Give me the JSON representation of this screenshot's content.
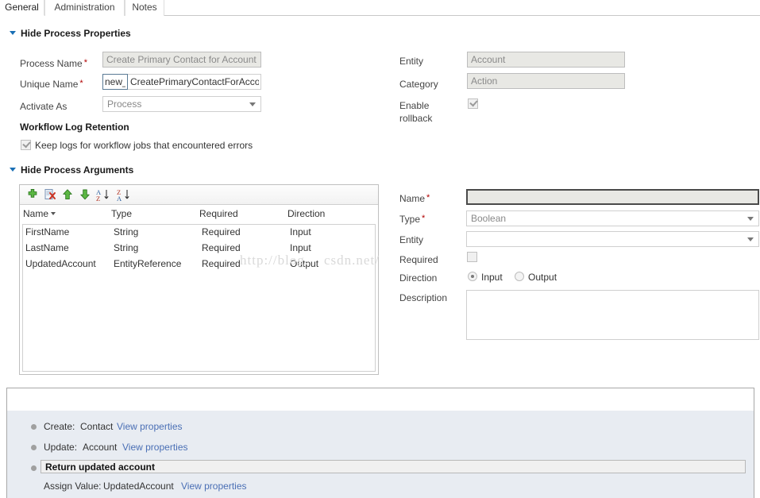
{
  "tabs": [
    {
      "label": "General",
      "active": true
    },
    {
      "label": "Administration",
      "active": false
    },
    {
      "label": "Notes",
      "active": false
    }
  ],
  "sections": {
    "properties_header": "Hide Process Properties",
    "arguments_header": "Hide Process Arguments",
    "log_retention_header": "Workflow Log Retention"
  },
  "properties": {
    "process_name_label": "Process Name",
    "process_name_value": "Create Primary Contact for Account",
    "unique_name_label": "Unique Name",
    "unique_name_prefix": "new_",
    "unique_name_value": "CreatePrimaryContactForAccount",
    "activate_as_label": "Activate As",
    "activate_as_value": "Process",
    "entity_label": "Entity",
    "entity_value": "Account",
    "category_label": "Category",
    "category_value": "Action",
    "enable_rollback_label": "Enable rollback",
    "enable_rollback_checked": true,
    "keep_logs_label": "Keep logs for workflow jobs that encountered errors",
    "keep_logs_checked": true
  },
  "arguments_toolbar": [
    {
      "name": "add-argument",
      "glyph": "+",
      "color": "#3d9b35"
    },
    {
      "name": "delete-argument",
      "glyph": "⌧",
      "color": "#c23c2a"
    },
    {
      "name": "move-up",
      "glyph": "▲",
      "color": "#3d9b35"
    },
    {
      "name": "move-down",
      "glyph": "▼",
      "color": "#3d9b35"
    },
    {
      "name": "sort-ascending",
      "glyph": "AZ",
      "color": "#3b6fa8"
    },
    {
      "name": "sort-descending",
      "glyph": "ZA",
      "color": "#3b6fa8"
    }
  ],
  "arguments_grid": {
    "columns": [
      "Name",
      "Type",
      "Required",
      "Direction"
    ],
    "sorted_column": "Name",
    "rows": [
      {
        "name": "FirstName",
        "type": "String",
        "required": "Required",
        "direction": "Input"
      },
      {
        "name": "LastName",
        "type": "String",
        "required": "Required",
        "direction": "Input"
      },
      {
        "name": "UpdatedAccount",
        "type": "EntityReference",
        "required": "Required",
        "direction": "Output"
      }
    ]
  },
  "argument_detail": {
    "name_label": "Name",
    "name_value": "",
    "type_label": "Type",
    "type_value": "Boolean",
    "entity_label": "Entity",
    "entity_value": "",
    "required_label": "Required",
    "required_checked": false,
    "direction_label": "Direction",
    "direction_input": "Input",
    "direction_output": "Output",
    "direction_selected": "Input",
    "description_label": "Description",
    "description_value": ""
  },
  "steps": [
    {
      "prefix": "Create:",
      "target": "Contact",
      "link": "View properties",
      "selected": false,
      "has_bullet": true
    },
    {
      "prefix": "Update:",
      "target": "Account",
      "link": "View properties",
      "selected": false,
      "has_bullet": true
    },
    {
      "prefix": "Return updated account",
      "target": "",
      "link": "",
      "selected": true,
      "has_bullet": true
    },
    {
      "prefix": "Assign Value:",
      "target": "UpdatedAccount",
      "link": "View properties",
      "selected": false,
      "has_bullet": false
    }
  ],
  "watermark": {
    "line1": "http://blog.",
    "line2": "csdn.net/"
  },
  "colors": {
    "accent": "#1a6fb5",
    "link": "#4a6fb5",
    "required_star": "#b00000",
    "panel_bg": "#e8ecf2"
  }
}
